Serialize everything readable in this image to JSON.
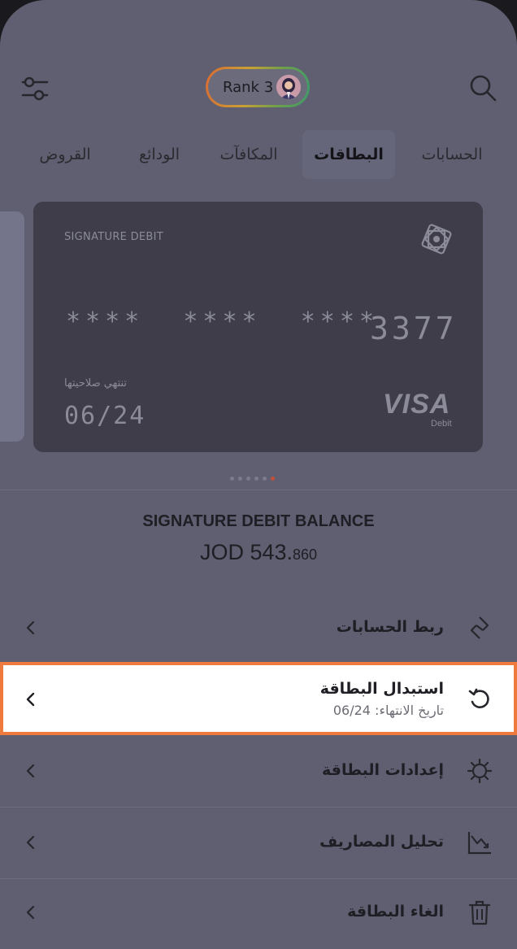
{
  "header": {
    "filter_icon": "filter-sliders-icon",
    "search_icon": "search-icon",
    "rank_label": "Rank 3",
    "avatar_icon": "avatar"
  },
  "tabs": [
    {
      "label": "الحسابات",
      "active": false
    },
    {
      "label": "البطاقات",
      "active": true
    },
    {
      "label": "المكافآت",
      "active": false
    },
    {
      "label": "الودائع",
      "active": false
    },
    {
      "label": "القروض",
      "active": false
    }
  ],
  "card": {
    "type_label": "SIGNATURE DEBIT",
    "masked_groups": "****  ****  ****",
    "last4": "3377",
    "expiry_label": "تنتهي صلاحيتها",
    "expiry_value": "06/24",
    "network": "VISA",
    "network_sub": "Debit"
  },
  "pager": {
    "count": 6,
    "active_index": 5
  },
  "balance": {
    "title": "SIGNATURE DEBIT BALANCE",
    "amount_main": "JOD 543.",
    "amount_fraction": "860"
  },
  "menu": [
    {
      "label": "ربط الحسابات",
      "icon": "link-accounts-icon"
    },
    {
      "label": "استبدال البطاقة",
      "subtitle": "تاريخ الانتهاء: 06/24",
      "icon": "replace-card-icon",
      "highlighted": true
    },
    {
      "label": "إعدادات البطاقة",
      "icon": "settings-gear-icon"
    },
    {
      "label": "تحليل المصاريف",
      "icon": "spending-analysis-icon"
    },
    {
      "label": "الغاء البطاقة",
      "icon": "trash-icon"
    }
  ],
  "colors": {
    "highlight_border": "#ef7a3e",
    "overlay": "#5f5f71"
  }
}
